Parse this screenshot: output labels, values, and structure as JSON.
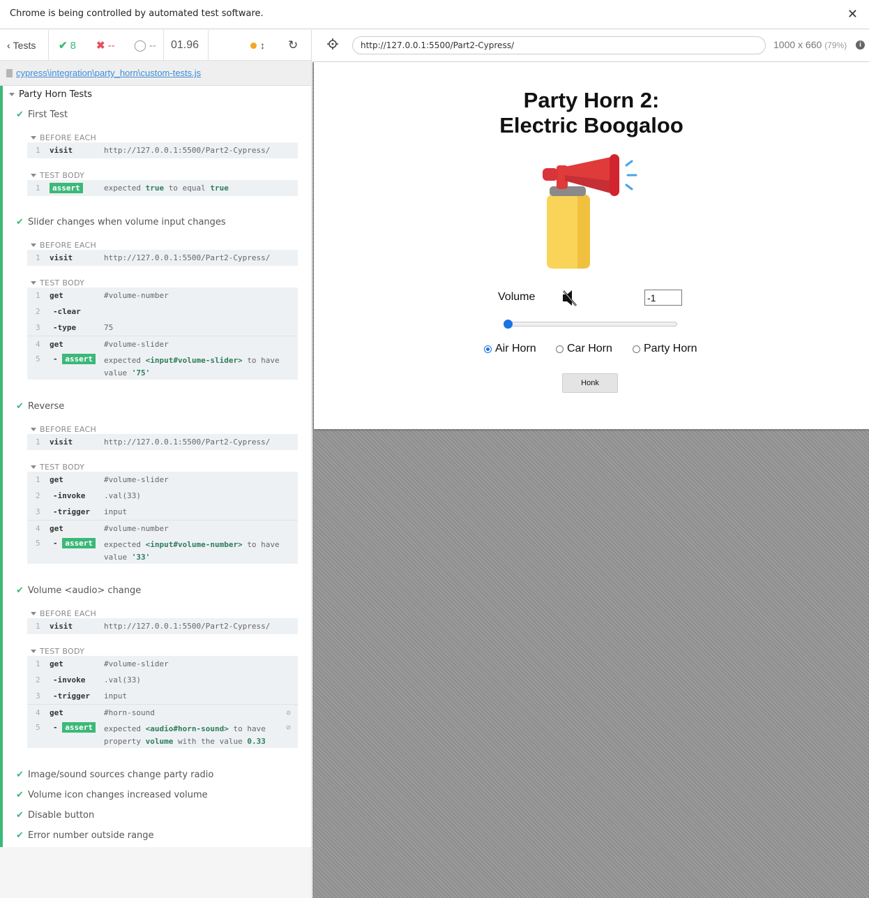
{
  "infobar": {
    "message": "Chrome is being controlled by automated test software."
  },
  "stats": {
    "tests_label": "Tests",
    "passed": "8",
    "failed": "--",
    "pending": "--",
    "duration": "01.96"
  },
  "file": {
    "path": "cypress\\integration\\party_horn\\custom-tests.js"
  },
  "suite": {
    "title": "Party Horn Tests"
  },
  "hooks": {
    "before_each": "BEFORE EACH",
    "test_body": "TEST BODY"
  },
  "visit": {
    "name": "visit",
    "url": "http://127.0.0.1:5500/Part2-Cypress/"
  },
  "tests": [
    {
      "title": "First Test",
      "body": {
        "badge": "assert",
        "pre": "expected",
        "v1": "true",
        "mid": "to equal",
        "v2": "true"
      }
    },
    {
      "title": "Slider changes when volume input changes",
      "cmd1": {
        "name": "get",
        "msg": "#volume-number"
      },
      "cmd2": {
        "name": "-clear",
        "msg": ""
      },
      "cmd3": {
        "name": "-type",
        "msg": "75"
      },
      "cmd4": {
        "name": "get",
        "msg": "#volume-slider"
      },
      "assert": {
        "badge": "assert",
        "pre": "expected",
        "el": "<input#volume-slider>",
        "mid": "to have",
        "line2pre": "value",
        "val": "'75'"
      }
    },
    {
      "title": "Reverse",
      "cmd1": {
        "name": "get",
        "msg": "#volume-slider"
      },
      "cmd2": {
        "name": "-invoke",
        "msg": ".val(33)"
      },
      "cmd3": {
        "name": "-trigger",
        "msg": "input"
      },
      "cmd4": {
        "name": "get",
        "msg": "#volume-number"
      },
      "assert": {
        "badge": "assert",
        "pre": "expected",
        "el": "<input#volume-number>",
        "mid": "to have",
        "line2pre": "value",
        "val": "'33'"
      }
    },
    {
      "title": "Volume <audio> change",
      "cmd1": {
        "name": "get",
        "msg": "#volume-slider"
      },
      "cmd2": {
        "name": "-invoke",
        "msg": ".val(33)"
      },
      "cmd3": {
        "name": "-trigger",
        "msg": "input"
      },
      "cmd4": {
        "name": "get",
        "msg": "#horn-sound"
      },
      "assert": {
        "badge": "assert",
        "pre": "expected",
        "el": "<audio#horn-sound>",
        "mid": "to have",
        "line2pre": "property",
        "prop": "volume",
        "line2mid": "with the value",
        "val": "0.33"
      }
    }
  ],
  "collapsed_tests": [
    "Image/sound sources change party radio",
    "Volume icon changes increased volume",
    "Disable button",
    "Error number outside range"
  ],
  "aut_header": {
    "url": "http://127.0.0.1:5500/Part2-Cypress/",
    "viewport": "1000 x 660",
    "scale": "(79%)"
  },
  "app": {
    "title_line1": "Party Horn 2:",
    "title_line2": "Electric Boogaloo",
    "volume_label": "Volume",
    "volume_value": "-1",
    "slider_value": 0,
    "radios": [
      "Air Horn",
      "Car Horn",
      "Party Horn"
    ],
    "selected_radio": "Air Horn",
    "honk_label": "Honk"
  },
  "colors": {
    "pass": "#3cb878",
    "fail": "#e94f5f",
    "link": "#3c8dda",
    "radio": "#1a73e8"
  }
}
